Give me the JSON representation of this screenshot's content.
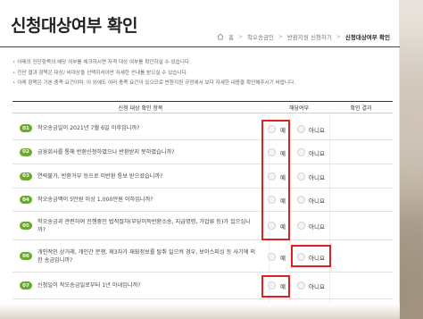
{
  "page": {
    "title": "신청대상여부 확인"
  },
  "breadcrumb": {
    "home": "홈",
    "items": [
      "착오송금인",
      "반환지원 신청하기",
      "신청대상여부 확인"
    ]
  },
  "notices": [
    "아래의 진단항목의 해당 여부를 체크하시면 자격 대상 여부를 확인하실 수 있습니다.",
    "진단 결과 항목은 대상/ 비대상을 선택하셔야만 자세한 안내를 받으실 수 있습니다.",
    "아래 항목은 기본 충족 요건이며, 이 외에도 여러 충족 요건이 있으므로 반환지원 규정에서 보다 자세한 내용을 확인해주시기 바랍니다."
  ],
  "table": {
    "headers": [
      "신청 대상 확인 항목",
      "해당여부",
      "확인 결과"
    ],
    "yes_label": "예",
    "no_label": "아니요",
    "rows": [
      {
        "num": "01",
        "question": "착오송금일이 2021년 7월 6일 이후입니까?"
      },
      {
        "num": "02",
        "question": "금융회사를 통해 반환신청하였으나 반환받지 못하였습니까?"
      },
      {
        "num": "03",
        "question": "연락불가, 반환거부 등으로 미반환 통보 받으셨습니까?"
      },
      {
        "num": "04",
        "question": "착오송금액이 5만원 이상 1,000만원 이하입니까?"
      },
      {
        "num": "05",
        "question": "착오송금과 관련하여 진행중인 법적절차(부당이득반환소송, 지급명령, 가압류 등)가 있으십니까?"
      },
      {
        "num": "06",
        "question": "개인적인 상거래, 개인간 분쟁, 제3자가 재화정보를 탈취 일으켜 경우, 보이스피싱 등 사기에 의한 송금입니까?"
      },
      {
        "num": "07",
        "question": "신청일이 착오송금일로부터 1년 이내입니까?"
      }
    ]
  },
  "colors": {
    "accent_green": "#6aaa2a",
    "highlight_red": "#e02020"
  }
}
